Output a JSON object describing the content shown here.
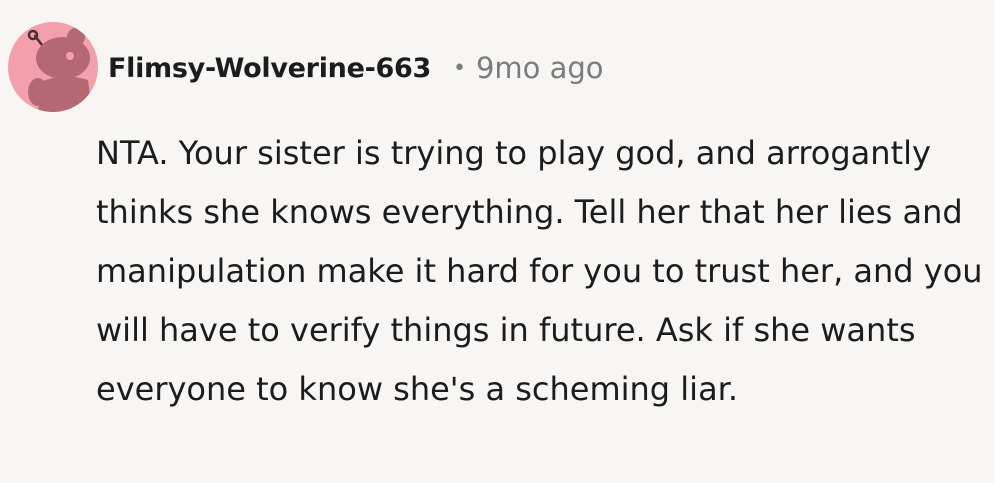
{
  "comment": {
    "author": "Flimsy-Wolverine-663",
    "separator": "•",
    "timestamp": "9mo ago",
    "body": "NTA. Your sister is trying to play god, and arrogantly thinks she knows everything. Tell her that her lies and manipulation make it hard for you to trust her, and you will have to verify things in future. Ask if she wants everyone to know she's a scheming liar."
  },
  "avatar": {
    "icon": "reddit-snoo-icon",
    "background_color": "#f2a0ac",
    "figure_color": "#b46874"
  },
  "colors": {
    "page_background": "#f7f6f4",
    "text": "#1c1c1c",
    "muted_text": "#7c7c7c"
  }
}
